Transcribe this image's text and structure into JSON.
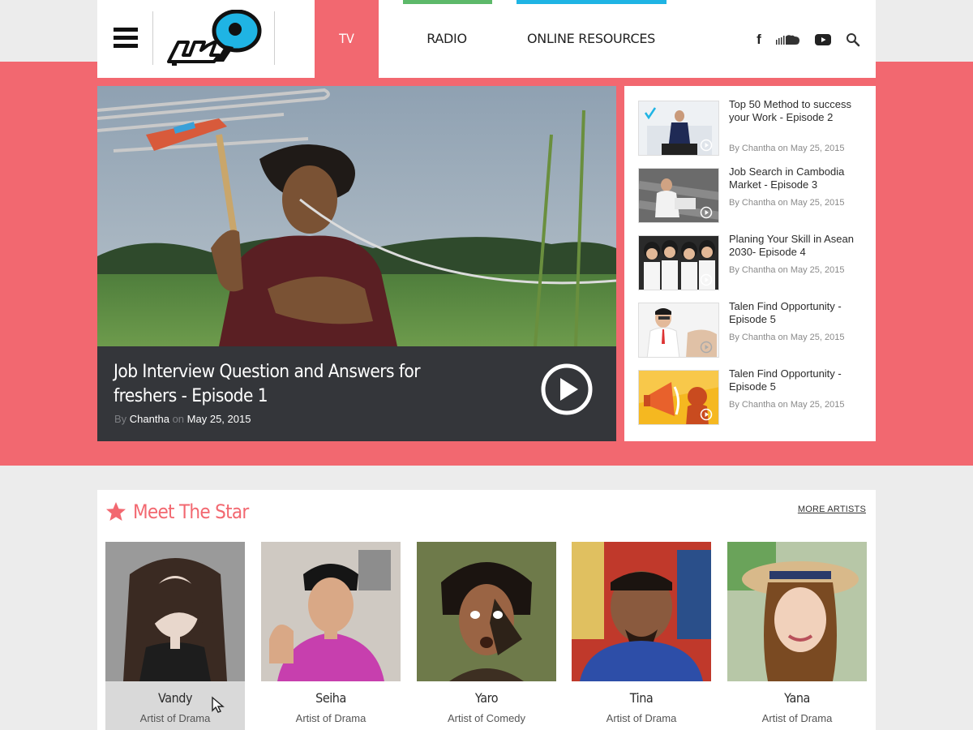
{
  "header": {
    "nav": {
      "tv": "TV",
      "radio": "RADIO",
      "online": "ONLINE RESOURCES"
    },
    "social": [
      "facebook-icon",
      "soundcloud-icon",
      "youtube-icon",
      "search-icon"
    ],
    "colors": {
      "tv": "#f26870",
      "radio": "#5db96a",
      "online": "#1fb4e4"
    }
  },
  "hero": {
    "title": "Job Interview Question and Answers for freshers - Episode 1",
    "by_label": "By",
    "author": "Chantha",
    "on_label": "on",
    "date": "May 25, 2015"
  },
  "playlist": [
    {
      "title": "Top 50 Method to success your Work - Episode 2",
      "by": "By Chantha on May 25, 2015"
    },
    {
      "title": "Job Search in Cambodia Market - Episode 3",
      "by": "By Chantha on May 25, 2015"
    },
    {
      "title": "Planing Your Skill in Asean 2030- Episode 4",
      "by": "By Chantha on May 25, 2015"
    },
    {
      "title": "Talen Find Opportunity - Episode 5",
      "by": "By Chantha on May 25, 2015"
    },
    {
      "title": "Talen Find Opportunity - Episode 5",
      "by": "By Chantha on May 25, 2015"
    }
  ],
  "stars": {
    "title": "Meet The Star",
    "more": "MORE ARTISTS",
    "artists": [
      {
        "name": "Vandy",
        "role": "Artist of Drama"
      },
      {
        "name": "Seiha",
        "role": "Artist of Drama"
      },
      {
        "name": "Yaro",
        "role": "Artist of Comedy"
      },
      {
        "name": "Tina",
        "role": "Artist of Drama"
      },
      {
        "name": "Yana",
        "role": "Artist of Drama"
      }
    ]
  }
}
